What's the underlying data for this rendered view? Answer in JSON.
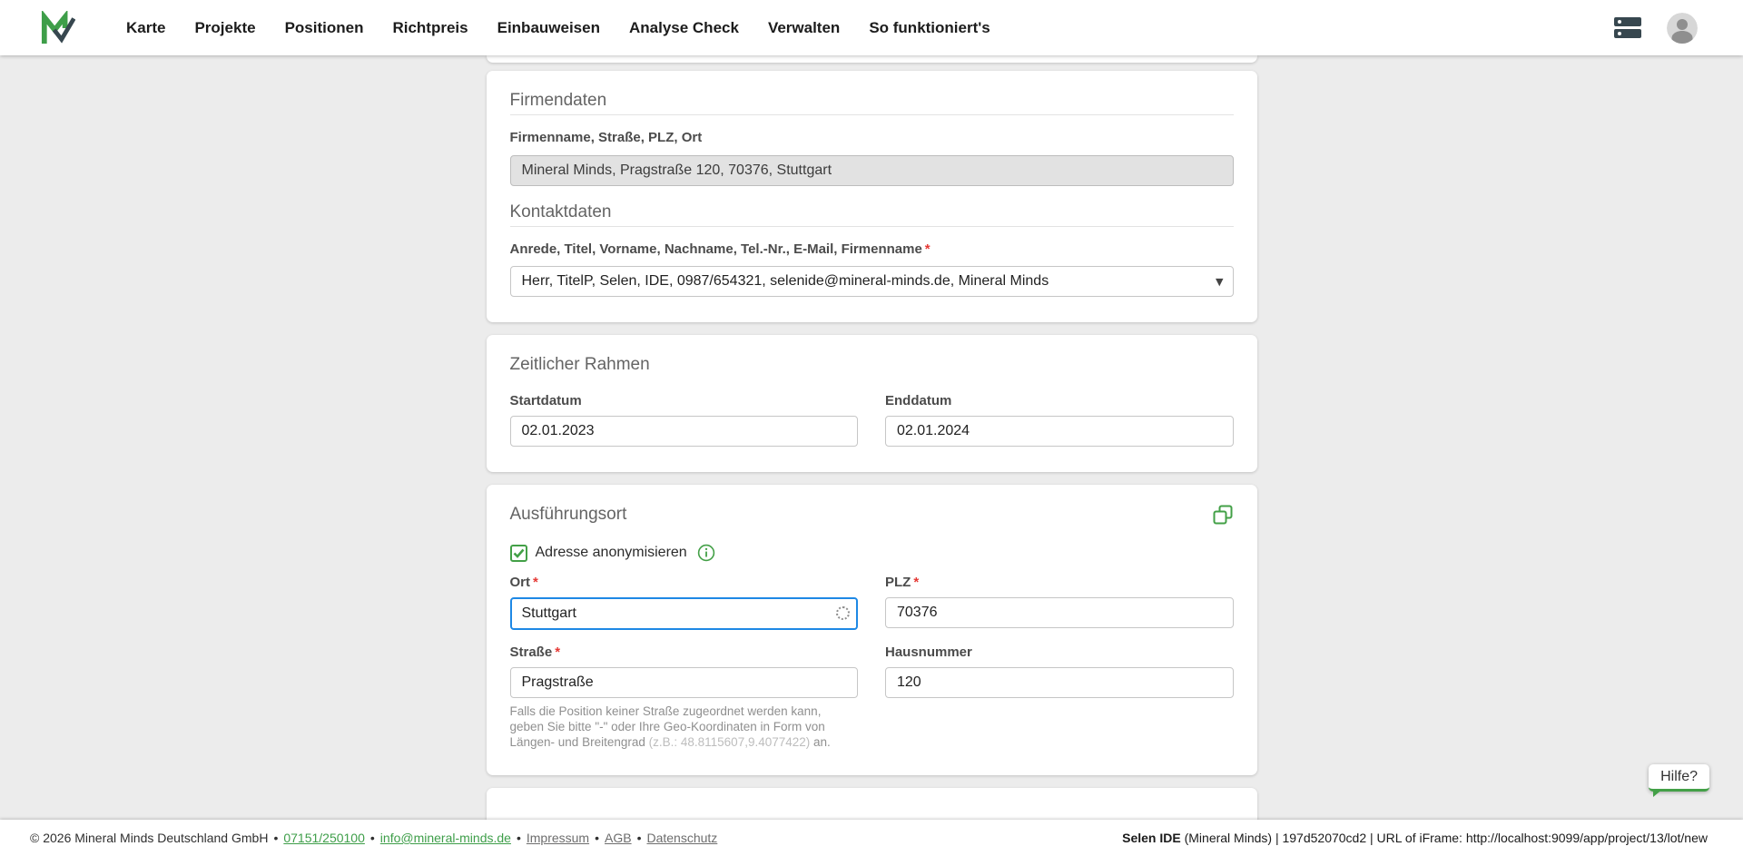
{
  "colors": {
    "accent_green": "#43a047",
    "focus_blue": "#1e88e5",
    "required_red": "#e53935",
    "background_gray": "#ececec"
  },
  "required_mark": "*",
  "icons": {
    "caret_down": "▾",
    "logo": "mineral-minds-logo",
    "top_right": [
      "server-icon",
      "user-avatar"
    ],
    "copy": "copy-icon",
    "info": "info-icon",
    "loading": "spinner-icon"
  },
  "nav": {
    "items": [
      "Karte",
      "Projekte",
      "Positionen",
      "Richtpreis",
      "Einbauweisen",
      "Analyse Check",
      "Verwalten",
      "So funktioniert's"
    ]
  },
  "firmendaten": {
    "title": "Firmendaten",
    "company_label": "Firmenname, Straße, PLZ, Ort",
    "company_value": "Mineral Minds, Pragstraße 120, 70376, Stuttgart",
    "kontakt_title": "Kontaktdaten",
    "kontakt_label": "Anrede, Titel, Vorname, Nachname, Tel.-Nr., E-Mail, Firmenname",
    "kontakt_value": "Herr, TitelP, Selen, IDE, 0987/654321, selenide@mineral-minds.de, Mineral Minds"
  },
  "zeitraum": {
    "title": "Zeitlicher Rahmen",
    "start_label": "Startdatum",
    "start_value": "02.01.2023",
    "end_label": "Enddatum",
    "end_value": "02.01.2024"
  },
  "ort": {
    "title": "Ausführungsort",
    "anonymize_label": "Adresse anonymisieren",
    "ort_label": "Ort",
    "ort_value": "Stuttgart",
    "plz_label": "PLZ",
    "plz_value": "70376",
    "strasse_label": "Straße",
    "strasse_value": "Pragstraße",
    "hausnummer_label": "Hausnummer",
    "hausnummer_value": "120",
    "hint_main": "Falls die Position keiner Straße zugeordnet werden kann, geben Sie bitte \"-\" oder Ihre Geo-Koordinaten in Form von Längen- und Breitengrad ",
    "hint_example": "(z.B.: 48.8115607,9.4077422)",
    "hint_end": " an."
  },
  "help": {
    "label": "Hilfe?"
  },
  "footer": {
    "separator": "•",
    "copyright": "© 2026 Mineral Minds Deutschland GmbH",
    "phone": "07151/250100",
    "email": "info@mineral-minds.de",
    "impressum": "Impressum",
    "agb": "AGB",
    "datenschutz": "Datenschutz",
    "session_bold": "Selen IDE",
    "session_rest": " (Mineral Minds) | 197d52070cd2 | URL of iFrame: http://localhost:9099/app/project/13/lot/new"
  }
}
